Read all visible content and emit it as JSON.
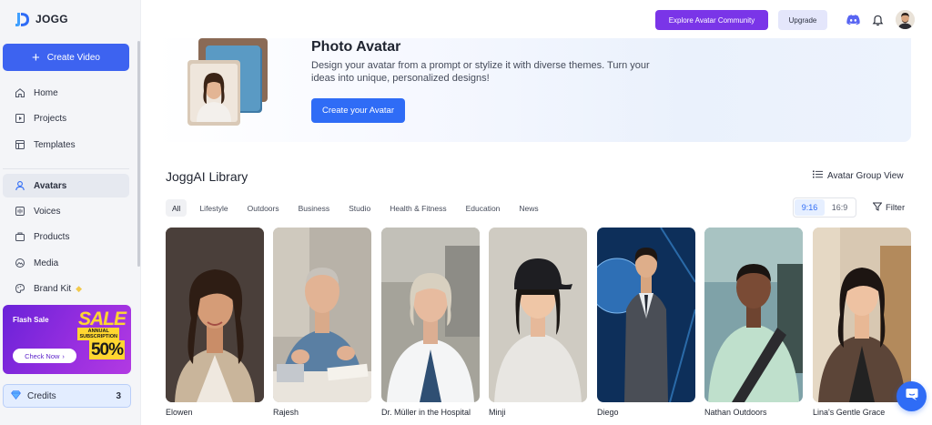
{
  "app": {
    "logo_text": "JOGG",
    "logo_icon": "jogg-logo-icon"
  },
  "sidebar": {
    "create_label": "Create Video",
    "items": [
      {
        "label": "Home",
        "icon": "home-icon"
      },
      {
        "label": "Projects",
        "icon": "projects-icon"
      },
      {
        "label": "Templates",
        "icon": "templates-icon"
      },
      {
        "label": "Avatars",
        "icon": "avatar-user-icon",
        "active": true
      },
      {
        "label": "Voices",
        "icon": "voice-icon"
      },
      {
        "label": "Products",
        "icon": "products-icon"
      },
      {
        "label": "Media",
        "icon": "media-icon"
      },
      {
        "label": "Brand Kit",
        "icon": "brand-kit-icon",
        "badge_icon": "diamond-icon"
      }
    ],
    "promo": {
      "title": "Flash Sale",
      "button": "Check Now",
      "sale_word": "SALE",
      "subtitle_line1": "ANNUAL",
      "subtitle_line2": "SUBSCRIPTION",
      "percent": "50%",
      "off_text": "OFF"
    },
    "credits": {
      "label": "Credits",
      "value": "3",
      "icon": "gem-icon"
    }
  },
  "topbar": {
    "explore_label": "Explore Avatar Community",
    "upgrade_label": "Upgrade",
    "icons": [
      "discord-icon",
      "bell-icon",
      "user-avatar"
    ]
  },
  "banner": {
    "title": "Photo Avatar",
    "description": "Design your avatar from a prompt or stylize it with diverse themes. Turn your ideas into unique, personalized designs!",
    "button_label": "Create your Avatar"
  },
  "library": {
    "title": "JoggAI Library",
    "group_view_label": "Avatar Group View",
    "tabs": [
      "All",
      "Lifestyle",
      "Outdoors",
      "Business",
      "Studio",
      "Health & Fitness",
      "Education",
      "News"
    ],
    "active_tab": "All",
    "ratios": [
      "9:16",
      "16:9"
    ],
    "active_ratio": "9:16",
    "filter_label": "Filter",
    "avatars": [
      {
        "name": "Elowen"
      },
      {
        "name": "Rajesh"
      },
      {
        "name": "Dr. Müller in the Hospital"
      },
      {
        "name": "Minji"
      },
      {
        "name": "Diego"
      },
      {
        "name": "Nathan Outdoors"
      },
      {
        "name": "Lina's Gentle Grace"
      }
    ]
  },
  "colors": {
    "primary": "#3d63f0",
    "explore": "#7a35e8",
    "promo": "#8a2ae0"
  }
}
